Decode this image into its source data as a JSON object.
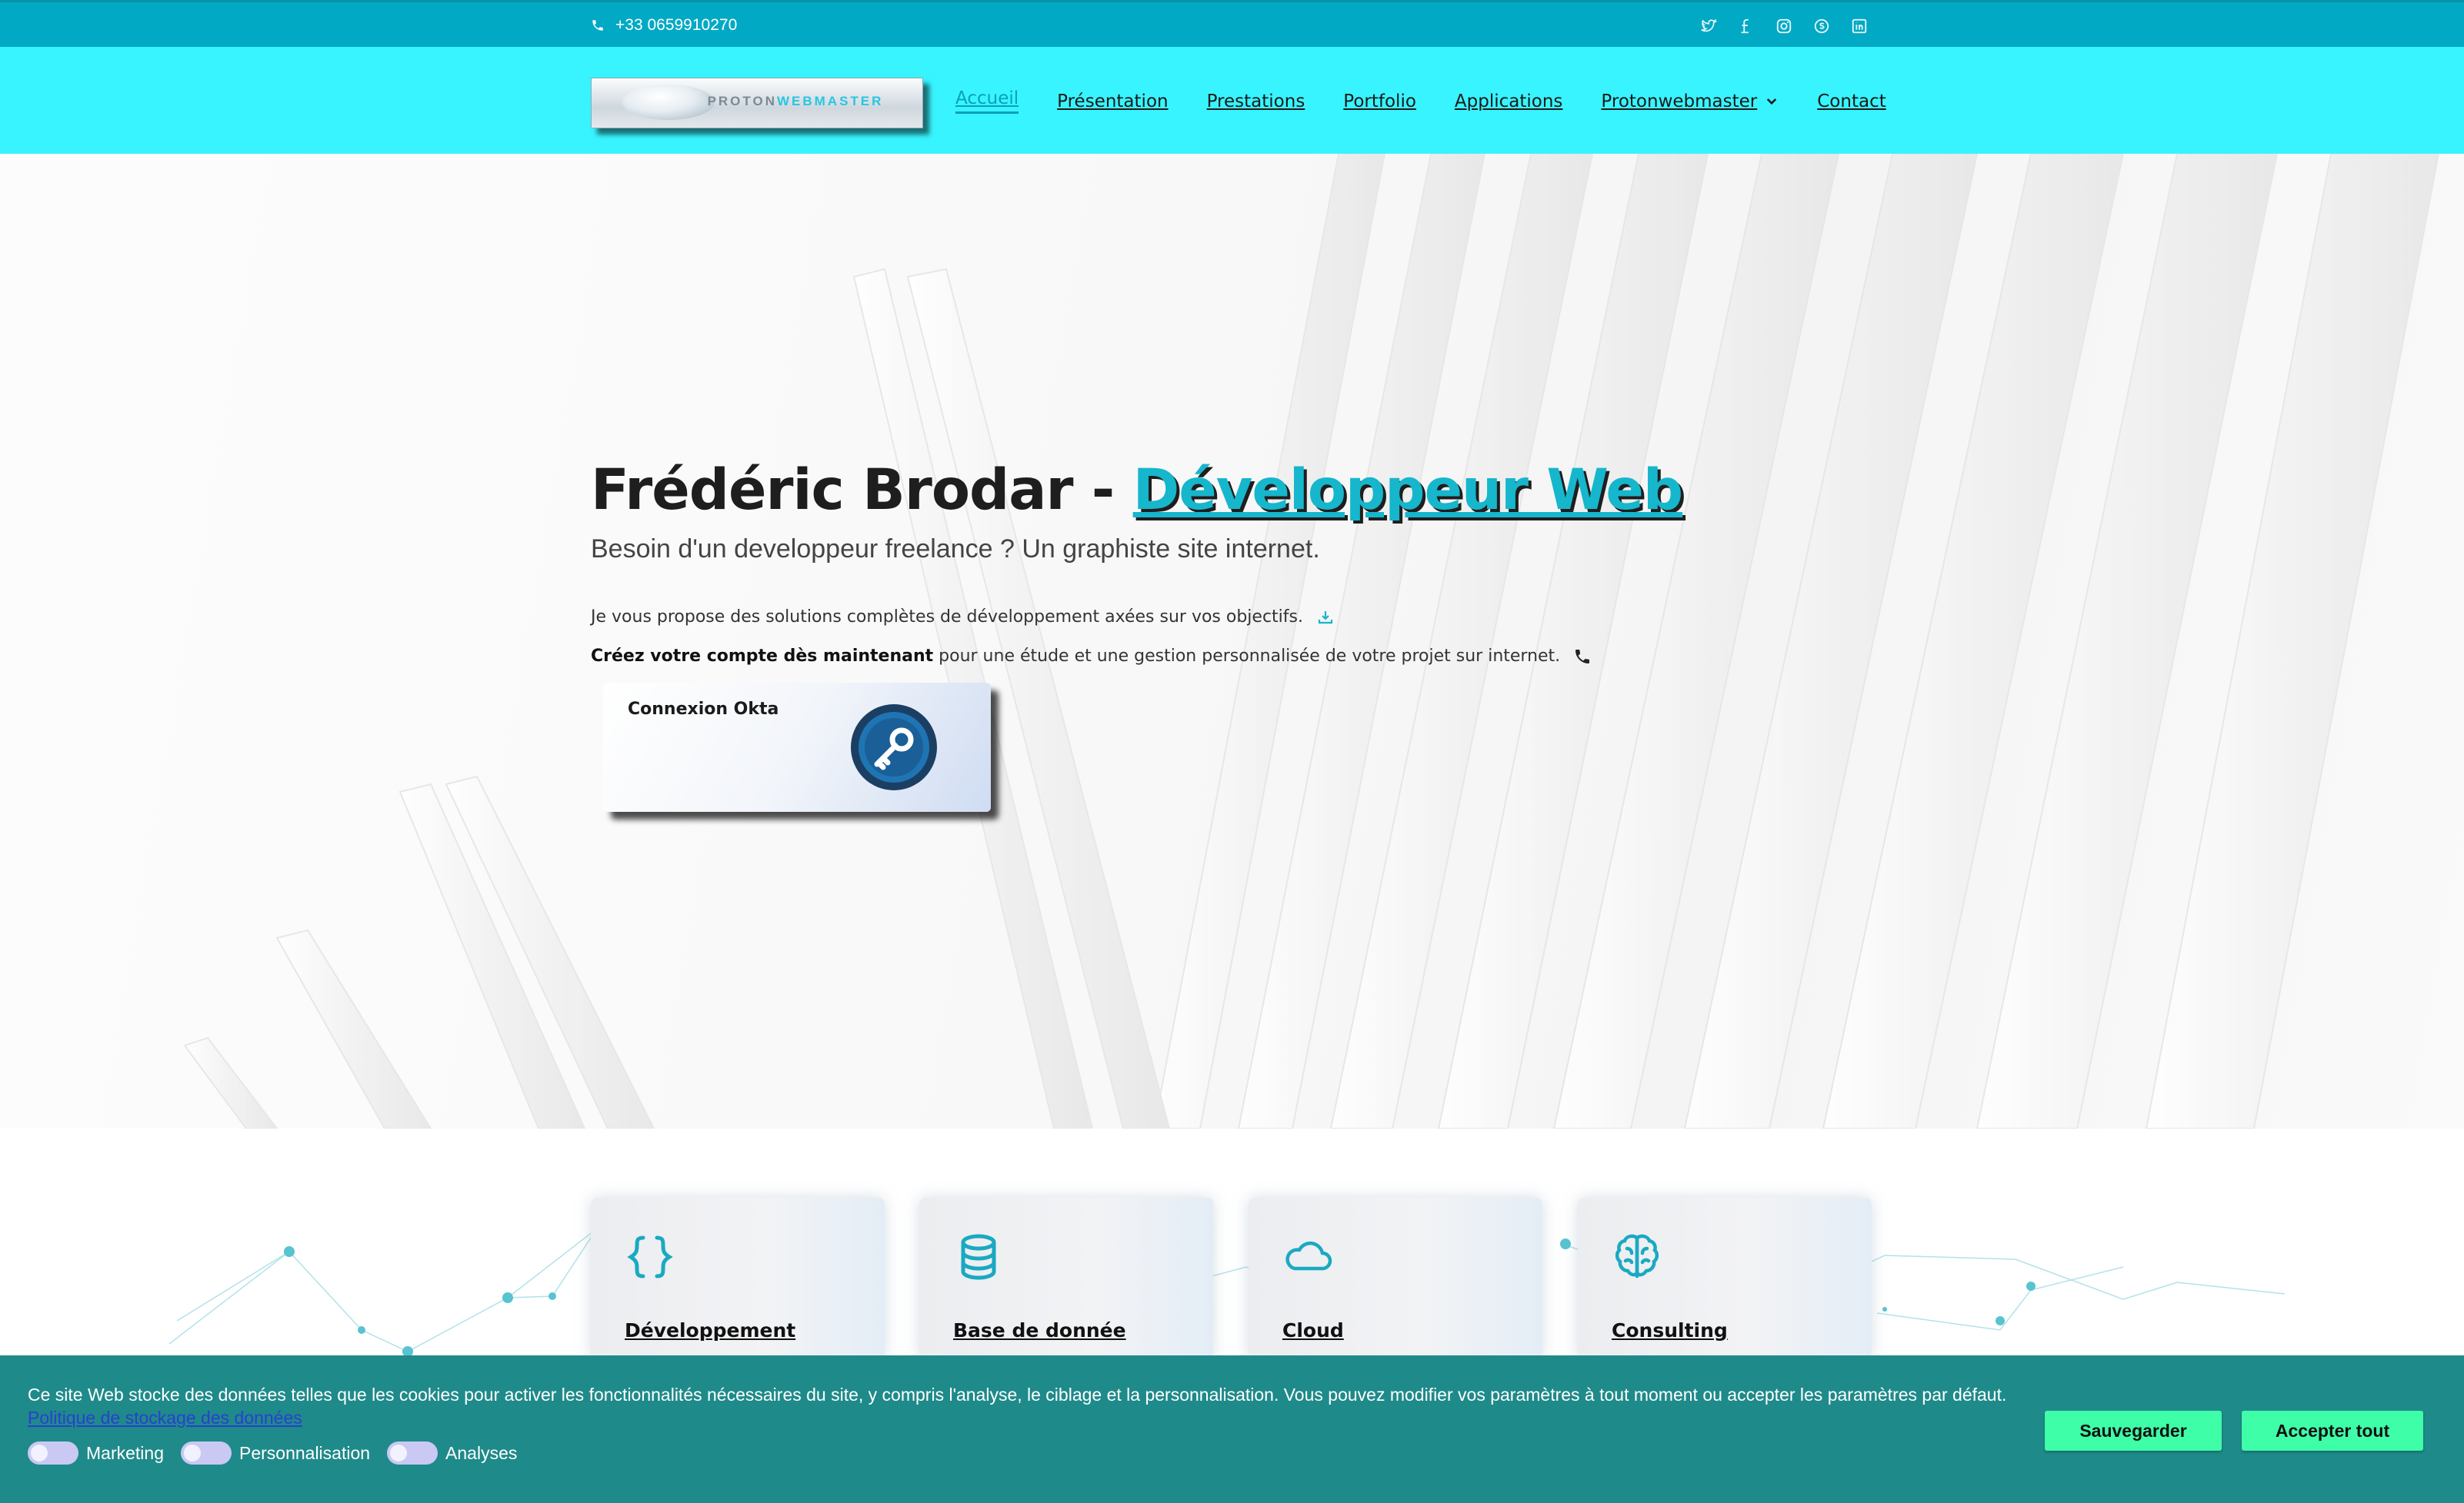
{
  "topbar": {
    "phone": "+33 0659910270",
    "social_icons": [
      "twitter-icon",
      "facebook-icon",
      "instagram-icon",
      "skype-icon",
      "linkedin-icon"
    ]
  },
  "header": {
    "logo_text_a": "PROTON",
    "logo_text_b": "WEBMASTER",
    "nav": [
      {
        "label": "Accueil",
        "active": true
      },
      {
        "label": "Présentation"
      },
      {
        "label": "Prestations"
      },
      {
        "label": "Portfolio"
      },
      {
        "label": "Applications"
      },
      {
        "label": "Protonwebmaster",
        "has_dropdown": true
      },
      {
        "label": "Contact"
      }
    ]
  },
  "hero": {
    "title_prefix": "Frédéric Brodar - ",
    "title_highlight": "Développeur Web",
    "subtitle": "Besoin d'un developpeur freelance ? Un graphiste site internet.",
    "line1": "Je vous propose des solutions complètes de développement axées sur vos objectifs.",
    "line2_bold": "Créez votre compte dès maintenant",
    "line2_rest": " pour une étude et une gestion personnalisée de votre projet sur internet.",
    "okta_label": "Connexion Okta"
  },
  "services": [
    {
      "title": "Développement",
      "icon": "code-braces-icon"
    },
    {
      "title": "Base de donnée",
      "icon": "database-icon"
    },
    {
      "title": "Cloud",
      "icon": "cloud-icon"
    },
    {
      "title": "Consulting",
      "icon": "brain-icon"
    }
  ],
  "cookie": {
    "message": "Ce site Web stocke des données telles que les cookies pour activer les fonctionnalités nécessaires du site, y compris l'analyse, le ciblage et la personnalisation. Vous pouvez modifier vos paramètres à tout moment ou accepter les paramètres par défaut.",
    "policy_link": "Politique de stockage des données",
    "toggles": [
      "Marketing",
      "Personnalisation",
      "Analyses"
    ],
    "save_label": "Sauvegarder",
    "accept_label": "Accepter tout"
  },
  "colors": {
    "topbar": "#02a9c4",
    "header": "#38f4ff",
    "accent": "#16b6cc",
    "cookie_bg": "#1f8a8a",
    "cookie_button": "#3effa8"
  }
}
